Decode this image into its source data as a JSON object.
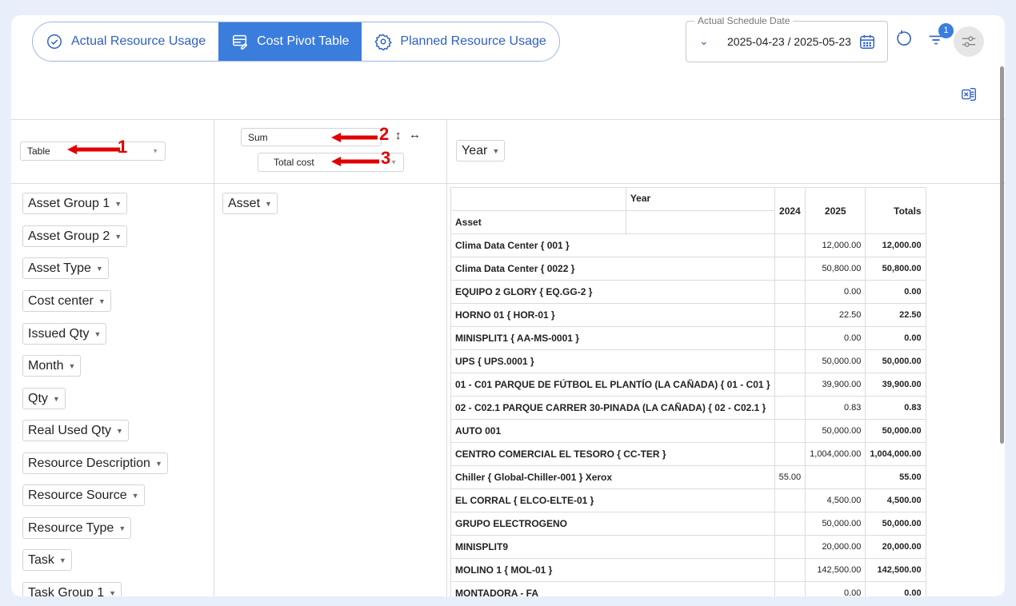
{
  "tabs": [
    {
      "label": "Actual Resource Usage",
      "icon": "check-circle-icon",
      "active": false
    },
    {
      "label": "Cost Pivot Table",
      "icon": "table-edit-icon",
      "active": true
    },
    {
      "label": "Planned Resource Usage",
      "icon": "gear-icon",
      "active": false
    }
  ],
  "date_filter": {
    "legend": "Actual Schedule Date",
    "value": "2025-04-23 / 2025-05-23"
  },
  "filter_badge": "1",
  "renderer": "Table",
  "aggregator": "Sum",
  "aggregator_value": "Total cost",
  "annotations": [
    "1",
    "2",
    "3"
  ],
  "sort_row_glyph": "↕",
  "sort_col_glyph": "↔",
  "col_attr": "Year",
  "row_attr": "Asset",
  "unused_attrs": [
    "Asset Group 1",
    "Asset Group 2",
    "Asset Type",
    "Cost center",
    "Issued Qty",
    "Month",
    "Qty",
    "Real Used Qty",
    "Resource Description",
    "Resource Source",
    "Resource Type",
    "Task",
    "Task Group 1"
  ],
  "table": {
    "col_header_label": "Year",
    "row_header_label": "Asset",
    "years": [
      "2024",
      "2025"
    ],
    "totals_label": "Totals",
    "rows": [
      {
        "asset": "Clima Data Center { 001 }",
        "y2024": "",
        "y2025": "12,000.00",
        "total": "12,000.00"
      },
      {
        "asset": "Clima Data Center { 0022 }",
        "y2024": "",
        "y2025": "50,800.00",
        "total": "50,800.00"
      },
      {
        "asset": "EQUIPO 2 GLORY { EQ.GG-2 }",
        "y2024": "",
        "y2025": "0.00",
        "total": "0.00"
      },
      {
        "asset": "HORNO 01 { HOR-01 }",
        "y2024": "",
        "y2025": "22.50",
        "total": "22.50"
      },
      {
        "asset": "MINISPLIT1 { AA-MS-0001 }",
        "y2024": "",
        "y2025": "0.00",
        "total": "0.00"
      },
      {
        "asset": "UPS { UPS.0001 }",
        "y2024": "",
        "y2025": "50,000.00",
        "total": "50,000.00"
      },
      {
        "asset": "01 - C01 PARQUE DE FÚTBOL EL PLANTÍO (LA CAÑADA) { 01 - C01 }",
        "y2024": "",
        "y2025": "39,900.00",
        "total": "39,900.00"
      },
      {
        "asset": "02 - C02.1 PARQUE CARRER 30-PINADA (LA CAÑADA) { 02 - C02.1 }",
        "y2024": "",
        "y2025": "0.83",
        "total": "0.83"
      },
      {
        "asset": "AUTO 001",
        "y2024": "",
        "y2025": "50,000.00",
        "total": "50,000.00"
      },
      {
        "asset": "CENTRO COMERCIAL EL TESORO { CC-TER }",
        "y2024": "",
        "y2025": "1,004,000.00",
        "total": "1,004,000.00"
      },
      {
        "asset": "Chiller { Global-Chiller-001 } Xerox",
        "y2024": "55.00",
        "y2025": "",
        "total": "55.00"
      },
      {
        "asset": "EL CORRAL { ELCO-ELTE-01 }",
        "y2024": "",
        "y2025": "4,500.00",
        "total": "4,500.00"
      },
      {
        "asset": "GRUPO ELECTROGENO",
        "y2024": "",
        "y2025": "50,000.00",
        "total": "50,000.00"
      },
      {
        "asset": "MINISPLIT9",
        "y2024": "",
        "y2025": "20,000.00",
        "total": "20,000.00"
      },
      {
        "asset": "MOLINO 1 { MOL-01 }",
        "y2024": "",
        "y2025": "142,500.00",
        "total": "142,500.00"
      },
      {
        "asset": "MONTADORA - FA",
        "y2024": "",
        "y2025": "0.00",
        "total": "0.00"
      }
    ]
  },
  "colors": {
    "accent": "#3b7ddd",
    "annotation": "#e00000",
    "background": "#e9eefb"
  }
}
